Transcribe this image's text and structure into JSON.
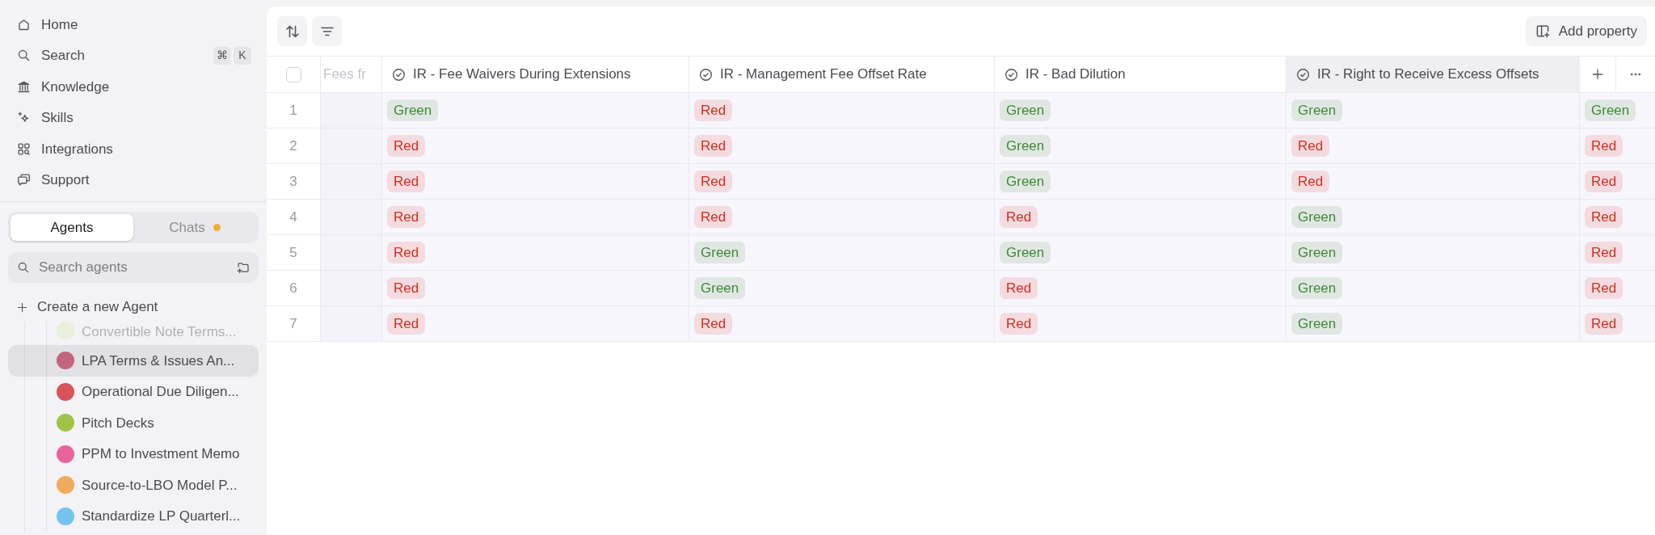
{
  "sidebar": {
    "nav": [
      {
        "label": "Home"
      },
      {
        "label": "Search",
        "shortcut": [
          "⌘",
          "K"
        ]
      },
      {
        "label": "Knowledge"
      },
      {
        "label": "Skills"
      },
      {
        "label": "Integrations"
      },
      {
        "label": "Support"
      }
    ],
    "tabs": [
      {
        "label": "Agents",
        "selected": true,
        "notification": false
      },
      {
        "label": "Chats",
        "selected": false,
        "notification": true
      }
    ],
    "agent_search": {
      "placeholder": "Search agents"
    },
    "create_agent": {
      "label": "Create a new Agent"
    },
    "agents": [
      {
        "name": "Convertible Note Terms...",
        "faded": true,
        "selected": false,
        "color": "#e8efdb"
      },
      {
        "name": "LPA Terms & Issues An...",
        "faded": false,
        "selected": true,
        "color": "#c4647e"
      },
      {
        "name": "Operational Due Diligen...",
        "faded": false,
        "selected": false,
        "color": "#d9525c"
      },
      {
        "name": "Pitch Decks",
        "faded": false,
        "selected": false,
        "color": "#9fc444"
      },
      {
        "name": "PPM to Investment Memo",
        "faded": false,
        "selected": false,
        "color": "#e8649c"
      },
      {
        "name": "Source-to-LBO Model P...",
        "faded": false,
        "selected": false,
        "color": "#f0aa5c"
      },
      {
        "name": "Standardize LP Quarterl...",
        "faded": false,
        "selected": false,
        "color": "#74c2f0"
      }
    ]
  },
  "toolbar": {
    "add_property": "Add property"
  },
  "table": {
    "header_checkbox": {
      "checked": false
    },
    "columns": [
      {
        "kind": "faded",
        "label": "Fees fr",
        "hovered": false
      },
      {
        "kind": "status",
        "label": "IR - Fee Waivers During Extensions",
        "hovered": false
      },
      {
        "kind": "status",
        "label": "IR - Management Fee Offset Rate",
        "hovered": false
      },
      {
        "kind": "status",
        "label": "IR - Bad Dilution",
        "hovered": false
      },
      {
        "kind": "status",
        "label": "IR - Right to Receive Excess Offsets",
        "hovered": true
      }
    ],
    "rows": [
      {
        "number": "1",
        "tags": [
          {
            "text": "Green",
            "color": "#3e8a36"
          },
          {
            "text": "Red",
            "color": "#d12f1f"
          },
          {
            "text": "Green",
            "color": "#3e8a36"
          },
          {
            "text": "Green",
            "color": "#3e8a36"
          },
          {
            "text": "Green",
            "color": "#3e8a36"
          }
        ]
      },
      {
        "number": "2",
        "tags": [
          {
            "text": "Red",
            "color": "#d12f1f"
          },
          {
            "text": "Red",
            "color": "#d12f1f"
          },
          {
            "text": "Green",
            "color": "#3e8a36"
          },
          {
            "text": "Red",
            "color": "#d12f1f"
          },
          {
            "text": "Red",
            "color": "#d12f1f"
          }
        ]
      },
      {
        "number": "3",
        "tags": [
          {
            "text": "Red",
            "color": "#d12f1f"
          },
          {
            "text": "Red",
            "color": "#d12f1f"
          },
          {
            "text": "Green",
            "color": "#3e8a36"
          },
          {
            "text": "Red",
            "color": "#d12f1f"
          },
          {
            "text": "Red",
            "color": "#d12f1f"
          }
        ]
      },
      {
        "number": "4",
        "tags": [
          {
            "text": "Red",
            "color": "#d12f1f"
          },
          {
            "text": "Red",
            "color": "#d12f1f"
          },
          {
            "text": "Red",
            "color": "#d12f1f"
          },
          {
            "text": "Green",
            "color": "#3e8a36"
          },
          {
            "text": "Red",
            "color": "#d12f1f"
          }
        ]
      },
      {
        "number": "5",
        "tags": [
          {
            "text": "Red",
            "color": "#d12f1f"
          },
          {
            "text": "Green",
            "color": "#3e8a36"
          },
          {
            "text": "Green",
            "color": "#3e8a36"
          },
          {
            "text": "Green",
            "color": "#3e8a36"
          },
          {
            "text": "Red",
            "color": "#d12f1f"
          }
        ]
      },
      {
        "number": "6",
        "tags": [
          {
            "text": "Red",
            "color": "#d12f1f"
          },
          {
            "text": "Green",
            "color": "#3e8a36"
          },
          {
            "text": "Red",
            "color": "#d12f1f"
          },
          {
            "text": "Green",
            "color": "#3e8a36"
          },
          {
            "text": "Red",
            "color": "#d12f1f"
          }
        ]
      },
      {
        "number": "7",
        "tags": [
          {
            "text": "Red",
            "color": "#d12f1f"
          },
          {
            "text": "Red",
            "color": "#d12f1f"
          },
          {
            "text": "Red",
            "color": "#d12f1f"
          },
          {
            "text": "Green",
            "color": "#3e8a36"
          },
          {
            "text": "Red",
            "color": "#d12f1f"
          }
        ]
      }
    ]
  }
}
